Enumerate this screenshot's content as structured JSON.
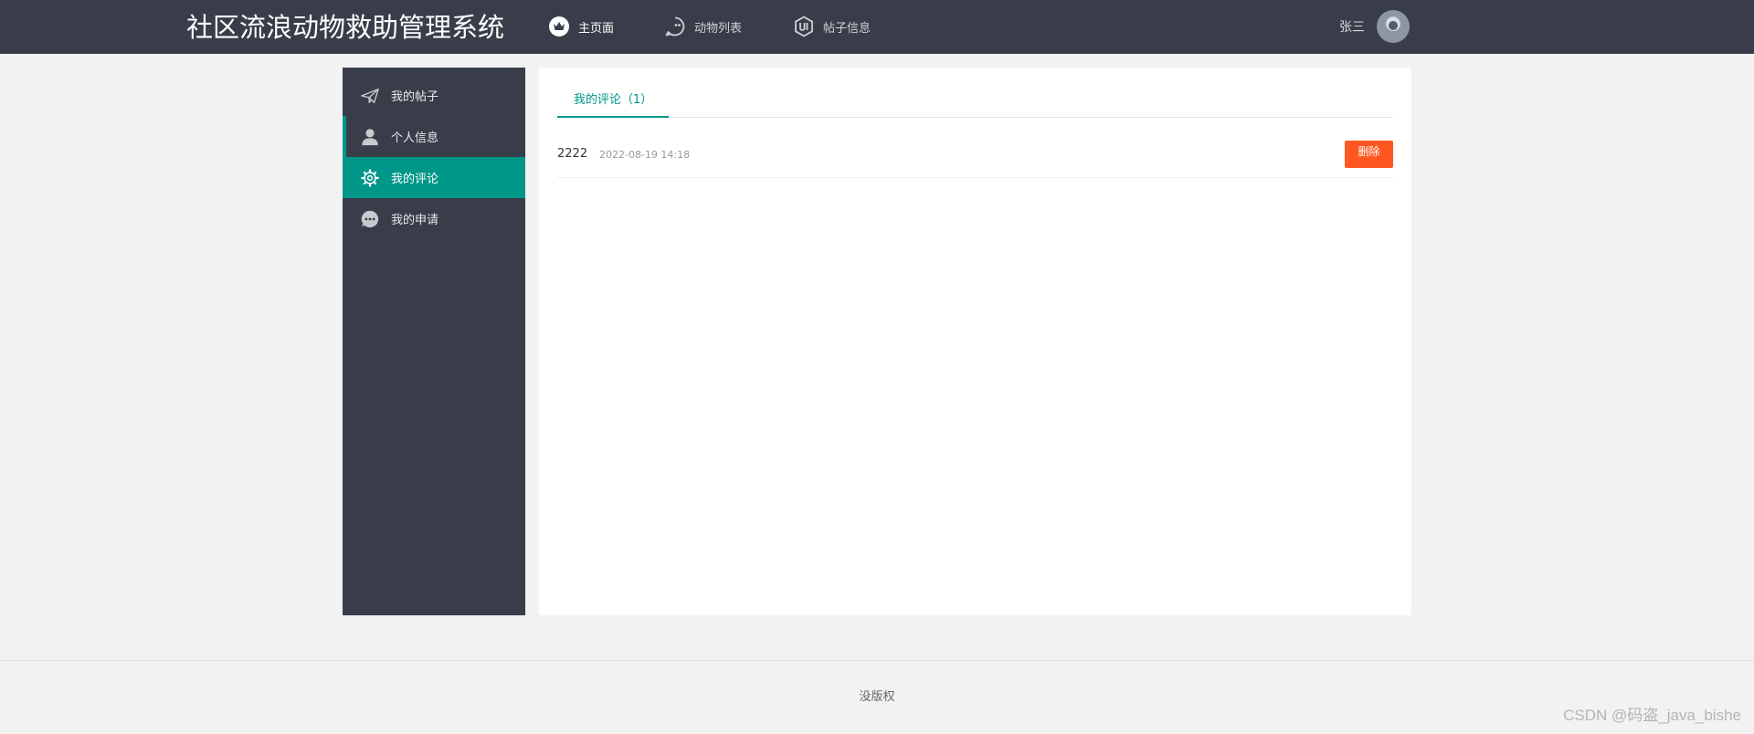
{
  "header": {
    "logo": "社区流浪动物救助管理系统",
    "nav": [
      {
        "label": "主页面",
        "icon": "crown-icon",
        "active": true
      },
      {
        "label": "动物列表",
        "icon": "chat-bubble-icon",
        "active": false
      },
      {
        "label": "帖子信息",
        "icon": "ui-hexagon-icon",
        "active": false
      }
    ],
    "user": {
      "name": "张三",
      "avatar": "avatar"
    }
  },
  "sidebar": {
    "items": [
      {
        "label": "我的帖子",
        "icon": "paper-plane-icon",
        "active": false
      },
      {
        "label": "个人信息",
        "icon": "user-icon",
        "active": false
      },
      {
        "label": "我的评论",
        "icon": "gear-icon",
        "active": true
      },
      {
        "label": "我的申请",
        "icon": "chat-dots-icon",
        "active": false
      }
    ]
  },
  "main": {
    "tab": "我的评论（1）",
    "comments": [
      {
        "text": "2222",
        "time": "2022-08-19 14:18",
        "delete_label": "删除"
      }
    ]
  },
  "footer": {
    "text": "没版权"
  },
  "watermark": "CSDN @码盗_java_bishe",
  "colors": {
    "header_bg": "#393d49",
    "accent": "#009688",
    "danger": "#ff5722",
    "page_bg": "#f2f2f2"
  }
}
